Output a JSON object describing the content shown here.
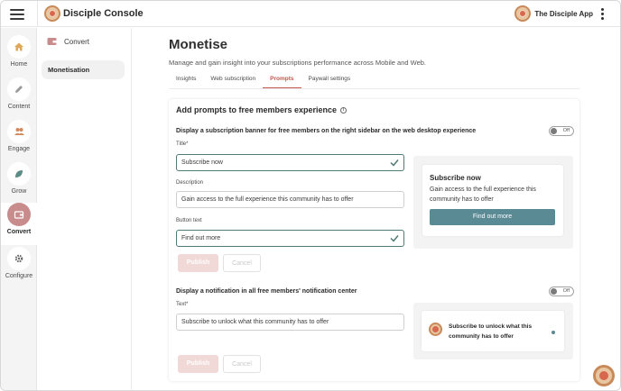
{
  "topbar": {
    "app_title": "Disciple Console",
    "community_name": "The Disciple App",
    "menu_icon": "hamburger-icon",
    "more_icon": "kebab-icon"
  },
  "rail": {
    "items": [
      {
        "label": "Home",
        "icon": "house-icon"
      },
      {
        "label": "Content",
        "icon": "pencil-icon"
      },
      {
        "label": "Engage",
        "icon": "users-icon"
      },
      {
        "label": "Grow",
        "icon": "leaf-icon"
      },
      {
        "label": "Convert",
        "icon": "wallet-icon",
        "active": true
      },
      {
        "label": "Configure",
        "icon": "gear-icon"
      }
    ]
  },
  "subnav": {
    "heading": "Convert",
    "items": [
      {
        "label": "Monetisation",
        "active": true
      }
    ]
  },
  "main": {
    "title": "Monetise",
    "subtitle": "Manage and gain insight into your subscriptions performance across Mobile and Web.",
    "tabs": [
      {
        "label": "Insights"
      },
      {
        "label": "Web subscription"
      },
      {
        "label": "Prompts",
        "active": true
      },
      {
        "label": "Paywall settings"
      }
    ]
  },
  "card": {
    "title": "Add prompts to free members experience",
    "banner": {
      "heading": "Display a subscription banner for free members on the right sidebar on the web desktop experience",
      "toggle_label": "Off",
      "title_label": "Title*",
      "title_value": "Subscribe now",
      "description_label": "Description",
      "description_value": "Gain access to the full experience this community has to offer",
      "button_label": "Button text",
      "button_value": "Find out more",
      "publish_label": "Publish",
      "cancel_label": "Cancel",
      "preview": {
        "title": "Subscribe now",
        "description": "Gain access to the full experience this community has to offer",
        "button": "Find out more"
      }
    },
    "notification": {
      "heading": "Display a notification in all free members' notification center",
      "toggle_label": "Off",
      "text_label": "Text*",
      "text_value": "Subscribe to unlock what this community has to offer",
      "publish_label": "Publish",
      "cancel_label": "Cancel",
      "preview": {
        "text": "Subscribe to unlock what this community has to offer"
      }
    }
  },
  "colors": {
    "accent": "#c0574e",
    "rail_active": "#c98c8c",
    "valid_border": "#4f7a76",
    "preview_button": "#5a8a93"
  }
}
